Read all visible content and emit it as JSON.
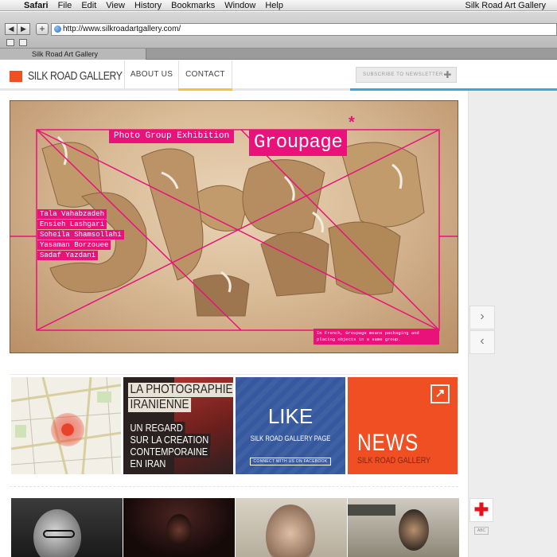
{
  "menubar": {
    "app": "Safari",
    "items": [
      "File",
      "Edit",
      "View",
      "History",
      "Bookmarks",
      "Window",
      "Help"
    ],
    "window_title": "Silk Road Art Gallery"
  },
  "browser": {
    "url": "http://www.silkroadartgallery.com/",
    "tab_title": "Silk Road Art Gallery"
  },
  "site": {
    "brand": "SILK ROAD GALLERY",
    "nav": {
      "about": "ABOUT US",
      "contact": "CONTACT"
    },
    "newsletter_placeholder": "SUBSCRIBE TO NEWSLETTER",
    "accent_colors": {
      "brand_orange": "#f04e23",
      "yellow": "#f5c242",
      "blue": "#38a9e0",
      "magenta": "#e8127a"
    }
  },
  "hero": {
    "title_small": "Photo Group Exhibition",
    "title_big": "Groupage",
    "star": "*",
    "artists": [
      "Tala Vahabzadeh",
      "Ensieh Lashgari",
      "Soheila Shamsollahi",
      "Yasaman Borzouee",
      "Sadaf Yazdani"
    ],
    "note": "In French, Groupage means packaging and placing objects in a same group."
  },
  "tiles": {
    "photo": {
      "line1": "LA PHOTOGRAPHIE",
      "line2": "IRANIENNE",
      "line3": "UN REGARD",
      "line4": "SUR LA CREATION",
      "line5": "CONTEMPORAINE",
      "line6": "EN IRAN"
    },
    "like": {
      "title": "LIKE",
      "subtitle": "SILK ROAD GALLERY PAGE",
      "button": "CONNECT WITH US ON FACEBOOK"
    },
    "news": {
      "title": "NEWS",
      "subtitle": "SILK ROAD GALLERY",
      "corner_icon": "arrow-up-right-icon"
    }
  },
  "side": {
    "next": "›",
    "prev": "‹",
    "cross_icon": "red-cross-icon",
    "badge": "ABC"
  }
}
